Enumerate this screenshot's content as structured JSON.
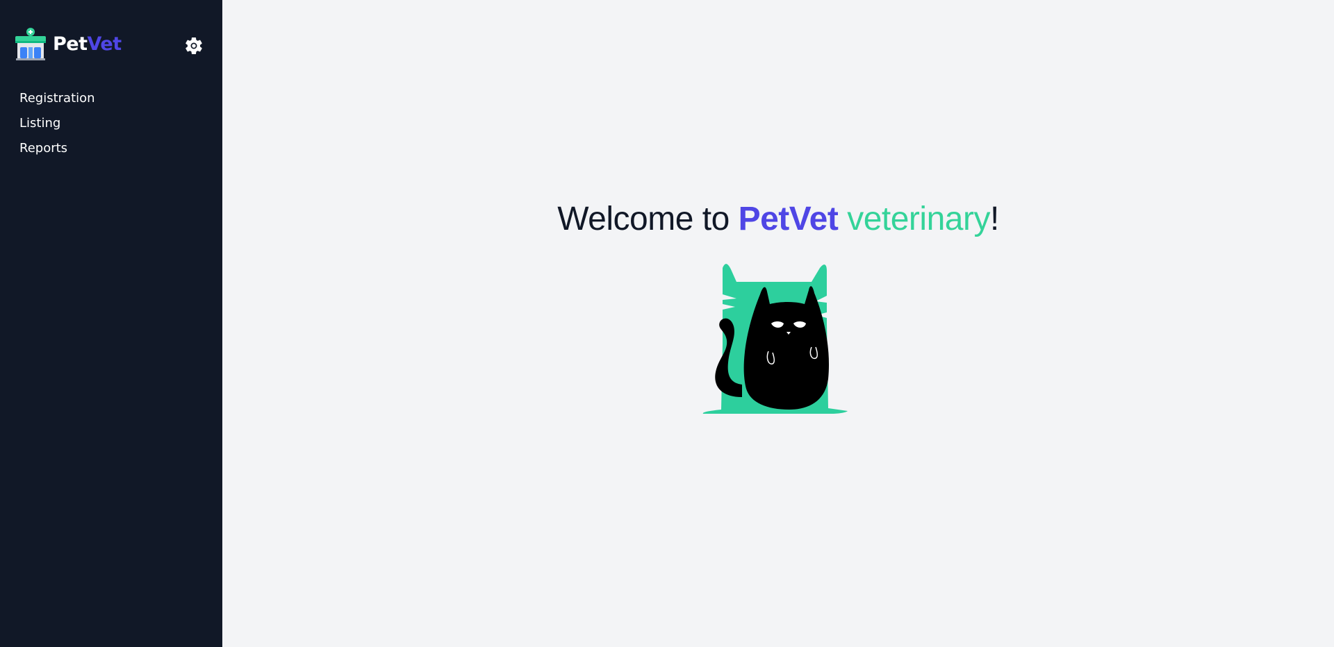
{
  "brand": {
    "name_part1": "Pet",
    "name_part2": "Vet",
    "logo_icon": "vet-clinic-storefront-icon"
  },
  "header": {
    "settings_icon": "gear-icon"
  },
  "sidebar": {
    "items": [
      {
        "label": "Registration"
      },
      {
        "label": "Listing"
      },
      {
        "label": "Reports"
      }
    ]
  },
  "main": {
    "welcome": {
      "prefix": "Welcome to ",
      "brand": "PetVet",
      "space": " ",
      "accent": "veterinary",
      "suffix": "!"
    },
    "illustration_icon": "black-cat-illustration"
  },
  "colors": {
    "sidebar_bg": "#111827",
    "main_bg": "#f3f4f6",
    "brand_primary": "#4f46e5",
    "brand_accent": "#34d399",
    "cat_backdrop": "#2dcf9d"
  }
}
